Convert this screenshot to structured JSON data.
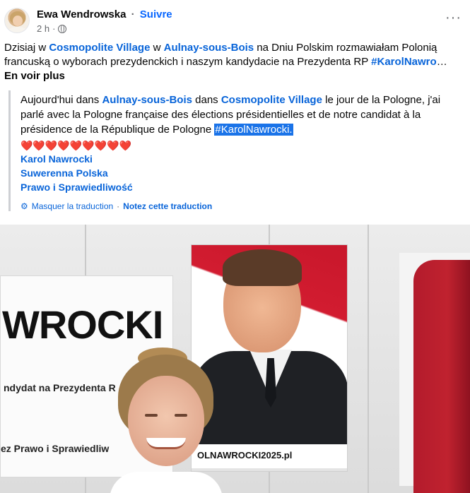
{
  "post": {
    "author": "Ewa Wendrowska",
    "follow_label": "Suivre",
    "separator": "·",
    "time": "2 h",
    "separator2": "·",
    "more_label": "···",
    "text_part1": "Dzisiaj w ",
    "place1": "Cosmopolite Village",
    "text_part2": " w ",
    "place2": "Aulnay-sous-Bois",
    "text_part3": " na Dniu Polskim rozmawiałam Polonią francuską o wyborach prezydenckich i naszym kandydacie na Prezydenta RP ",
    "hashtag": "#KarolNawro",
    "ellipsis": "… ",
    "see_more": "En voir plus"
  },
  "translation": {
    "part1": "Aujourd'hui dans ",
    "place1": "Aulnay-sous-Bois",
    "part2": " dans ",
    "place2": "Cosmopolite Village",
    "part3": " le jour de la Pologne, j'ai parlé avec la Pologne française des élections présidentielles et de notre candidat à la présidence de la République de Pologne ",
    "hashtag": "#KarolNawrocki.",
    "hearts": "❤️❤️❤️❤️❤️❤️❤️❤️❤️",
    "links": [
      "Karol Nawrocki",
      "Suwerenna Polska",
      "Prawo i Sprawiedliwość"
    ],
    "hide_label": "Masquer la traduction",
    "dot": "·",
    "rate_label": "Notez cette traduction"
  },
  "photo": {
    "banner_name": "WROCKI",
    "banner_subtitle": "ndydat na Prezydenta R",
    "banner_bottom": "ez Prawo i Sprawiedliw",
    "poster_url": "OLNAWROCKI2025.pl"
  },
  "colors": {
    "link": "#0864d9",
    "follow": "#0866ff",
    "meta": "#65676b"
  },
  "icons": [
    "globe-icon",
    "gear-icon",
    "more-options-icon"
  ]
}
